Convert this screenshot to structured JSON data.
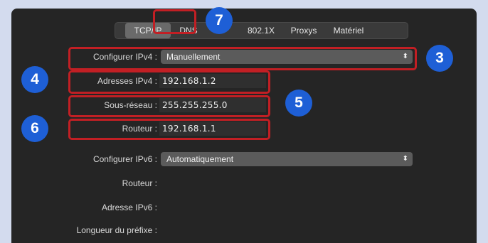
{
  "tabs": [
    "TCP/IP",
    "DNS",
    "802.1X",
    "Proxys",
    "Matériel"
  ],
  "ipv4": {
    "configure_label": "Configurer IPv4 :",
    "configure_value": "Manuellement",
    "address_label": "Adresses IPv4 :",
    "address_value": "192.168.1.2",
    "subnet_label": "Sous-réseau :",
    "subnet_value": "255.255.255.0",
    "router_label": "Routeur :",
    "router_value": "192.168.1.1"
  },
  "ipv6": {
    "configure_label": "Configurer IPv6 :",
    "configure_value": "Automatiquement",
    "router_label": "Routeur :",
    "address_label": "Adresse IPv6 :",
    "prefix_label": "Longueur du préfixe :"
  },
  "badges": [
    "3",
    "4",
    "5",
    "6",
    "7"
  ],
  "icons": {
    "popup_chevron": "chevron-updown-icon"
  },
  "colors": {
    "highlight": "#c21f24",
    "badge": "#1e5fd6",
    "panel": "#252525",
    "background": "#d3dbee"
  }
}
